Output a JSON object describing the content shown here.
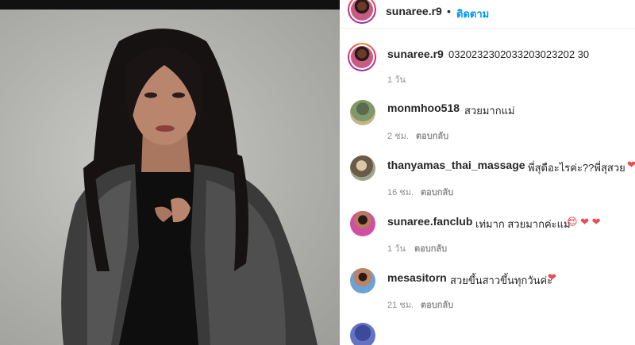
{
  "header": {
    "username": "sunaree.r9",
    "separator": "•",
    "follow_label": "ติดตาม"
  },
  "caption": {
    "username": "sunaree.r9",
    "text": "0320232302033203023202 30",
    "time": "1 วัน"
  },
  "comments": [
    {
      "username": "monmhoo518",
      "text": "สวยมากแม่",
      "time": "2 ชม.",
      "reply_label": "ตอบกลับ",
      "emoji": ""
    },
    {
      "username": "thanyamas_thai_massage",
      "text": "พี่สุดือะไรค่ะ??พี่สุสวย",
      "time": "16 ชม.",
      "reply_label": "ตอบกลับ",
      "emoji": "❤"
    },
    {
      "username": "sunaree.fanclub",
      "text": "เท่มาก สวยมากค่ะแม่",
      "time": "1 วัน",
      "reply_label": "ตอบกลับ",
      "emoji": "😍 ❤ ❤"
    },
    {
      "username": "mesasitorn",
      "text": "สวยขึ้นสาวขึ้นทุกวันค่ะ",
      "time": "21 ชม.",
      "reply_label": "ตอบกลับ",
      "emoji": "❤"
    }
  ],
  "colors": {
    "link_blue": "#0095f6",
    "meta_gray": "#8e8e8e",
    "heart_red": "#ed4956"
  }
}
